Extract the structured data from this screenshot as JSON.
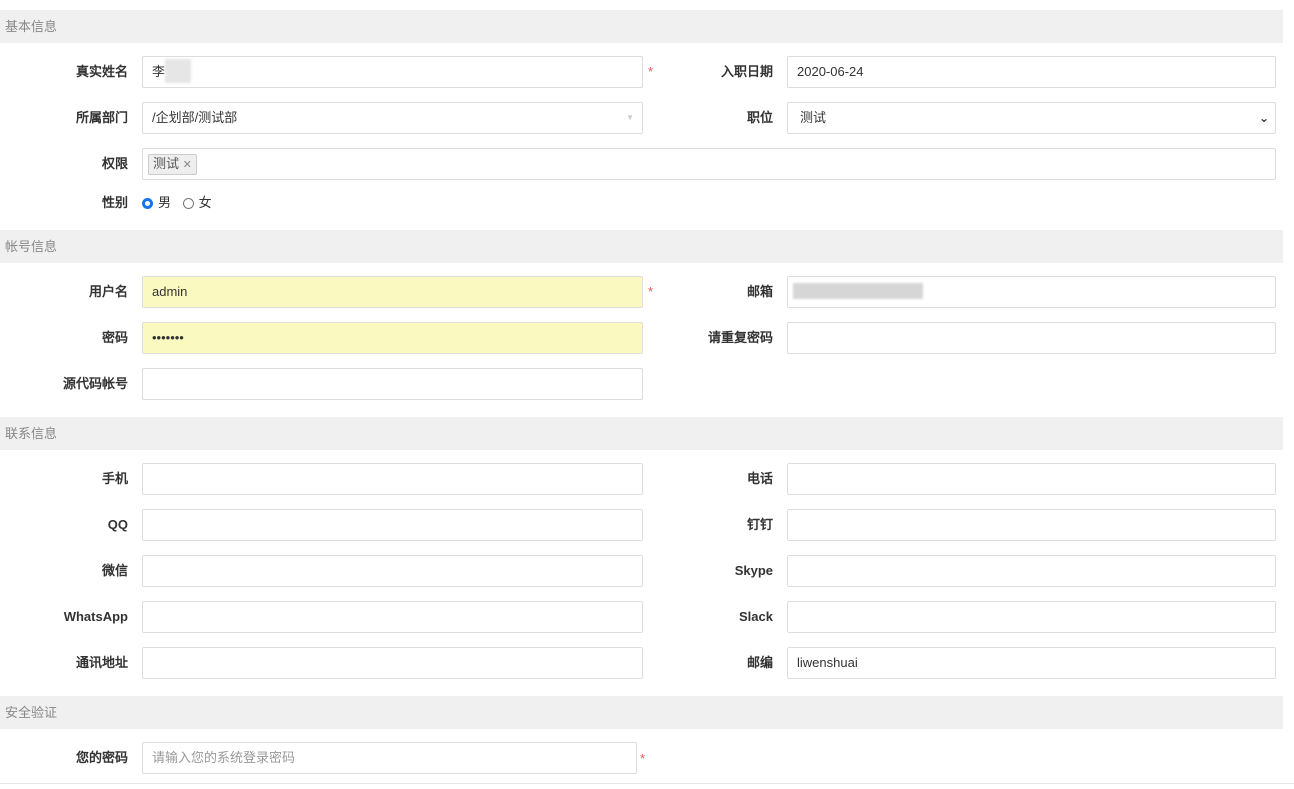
{
  "sections": {
    "basic": "基本信息",
    "account": "帐号信息",
    "contact": "联系信息",
    "security": "安全验证"
  },
  "basic": {
    "realname_label": "真实姓名",
    "realname_value": "李",
    "join_date_label": "入职日期",
    "join_date_value": "2020-06-24",
    "dept_label": "所属部门",
    "dept_value": "/企划部/测试部",
    "position_label": "职位",
    "position_value": "测试",
    "perm_label": "权限",
    "perm_tags": [
      "测试"
    ],
    "gender_label": "性别",
    "gender_options": [
      "男",
      "女"
    ],
    "gender_selected": "男"
  },
  "account": {
    "username_label": "用户名",
    "username_value": "admin",
    "email_label": "邮箱",
    "password_label": "密码",
    "password_value": "•••••••",
    "repeat_label": "请重复密码",
    "scm_label": "源代码帐号"
  },
  "contact": {
    "mobile_label": "手机",
    "phone_label": "电话",
    "qq_label": "QQ",
    "dingding_label": "钉钉",
    "wechat_label": "微信",
    "skype_label": "Skype",
    "whatsapp_label": "WhatsApp",
    "slack_label": "Slack",
    "address_label": "通讯地址",
    "zipcode_label": "邮编",
    "zipcode_value": "liwenshuai"
  },
  "security": {
    "verify_label": "您的密码",
    "verify_placeholder": "请输入您的系统登录密码"
  },
  "required_mark": "*",
  "colors": {
    "section_bg": "#f0f0f0",
    "autofill": "#fafac0",
    "required": "#e55555",
    "accent": "#1a73e8"
  }
}
